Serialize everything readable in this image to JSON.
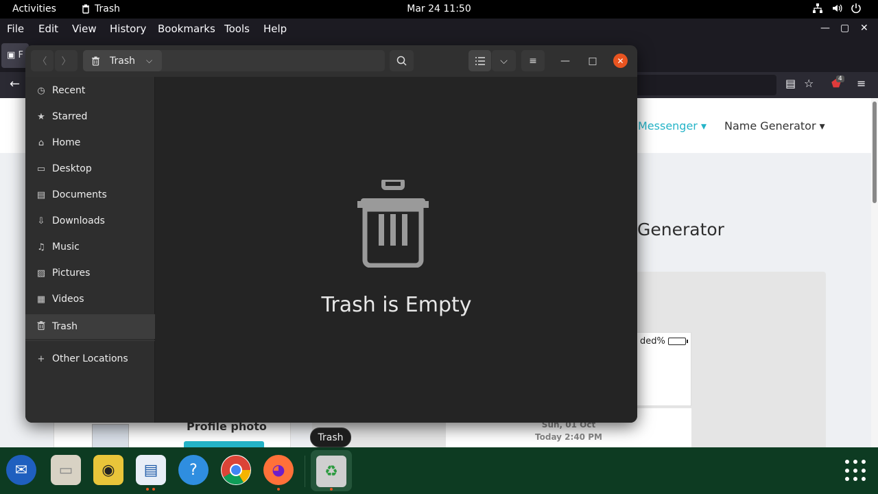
{
  "topbar": {
    "activities": "Activities",
    "app_name": "Trash",
    "clock": "Mar 24  11:50",
    "tray_icons": [
      "network-icon",
      "volume-icon",
      "power-icon"
    ]
  },
  "firefox": {
    "menu": [
      "File",
      "Edit",
      "View",
      "History",
      "Bookmarks",
      "Tools",
      "Help"
    ],
    "tab_title_fragment": "F",
    "ext_badge": "4"
  },
  "webpage": {
    "nav_messenger": "Messenger ▾",
    "nav_name_generator": "Name Generator ▾",
    "heading_fragment": "Generator",
    "mini_card_text": "ded%",
    "profile_title": "Profile photo",
    "date_line1": "Sun, 01 Oct",
    "date_line2": "Today 2:40 PM"
  },
  "nautilus": {
    "path_label": "Trash",
    "sidebar": [
      {
        "label": "Recent",
        "icon": "clock-icon",
        "glyph": "◷"
      },
      {
        "label": "Starred",
        "icon": "star-icon",
        "glyph": "★"
      },
      {
        "label": "Home",
        "icon": "home-icon",
        "glyph": "⌂"
      },
      {
        "label": "Desktop",
        "icon": "desktop-icon",
        "glyph": "▭"
      },
      {
        "label": "Documents",
        "icon": "document-icon",
        "glyph": "▤"
      },
      {
        "label": "Downloads",
        "icon": "download-icon",
        "glyph": "⇩"
      },
      {
        "label": "Music",
        "icon": "music-icon",
        "glyph": "♫"
      },
      {
        "label": "Pictures",
        "icon": "picture-icon",
        "glyph": "▨"
      },
      {
        "label": "Videos",
        "icon": "video-icon",
        "glyph": "▦"
      },
      {
        "label": "Trash",
        "icon": "trash-icon",
        "glyph": "🗑"
      },
      {
        "label": "Other Locations",
        "icon": "plus-icon",
        "glyph": "+"
      }
    ],
    "empty_message": "Trash is Empty"
  },
  "tooltip": "Trash",
  "dock": {
    "apps": [
      "thunderbird",
      "files",
      "rhythmbox",
      "libreoffice-writer",
      "help",
      "chrome",
      "firefox",
      "trash"
    ]
  },
  "colors": {
    "accent": "#e95420",
    "dock_bg": "#0d3b22",
    "window_bg": "#242424",
    "sidebar_bg": "#2e2e2e",
    "link_teal": "#25b4c8"
  }
}
